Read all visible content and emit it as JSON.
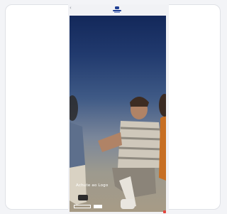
{
  "hero": {
    "headline": "Achute ao Logo"
  },
  "icons": {
    "back": "chevron-left-icon",
    "logo": "brand-logo-icon"
  },
  "colors": {
    "brand": "#1f3f93",
    "accent": "#e3453d"
  }
}
